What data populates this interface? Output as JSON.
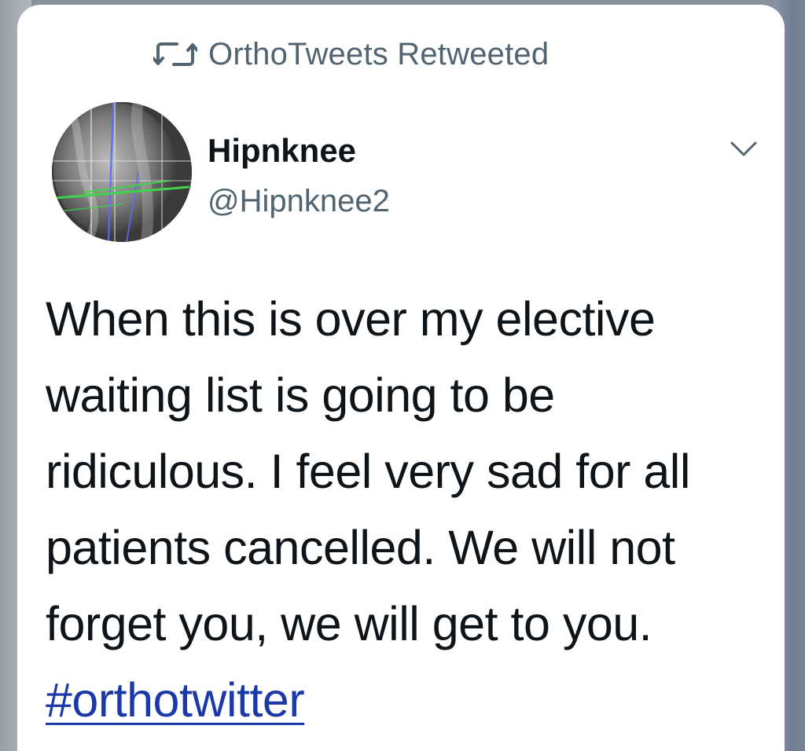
{
  "retweet": {
    "icon": "retweet-icon",
    "label": "OrthoTweets Retweeted"
  },
  "author": {
    "avatar": "xray-knee-avatar",
    "display_name": "Hipnknee",
    "handle": "@Hipnknee2"
  },
  "menu": {
    "icon": "chevron-down-icon"
  },
  "tweet": {
    "lines": [
      "When this is over my elective",
      "waiting list is going to be",
      "ridiculous. I feel very sad for all",
      "patients cancelled. We will not",
      "forget you, we will get to you."
    ],
    "hashtag": "#orthotwitter"
  },
  "colors": {
    "text_primary": "#0f1419",
    "text_secondary": "#536471",
    "link": "#1b3aa7",
    "card_bg": "#ffffff"
  }
}
